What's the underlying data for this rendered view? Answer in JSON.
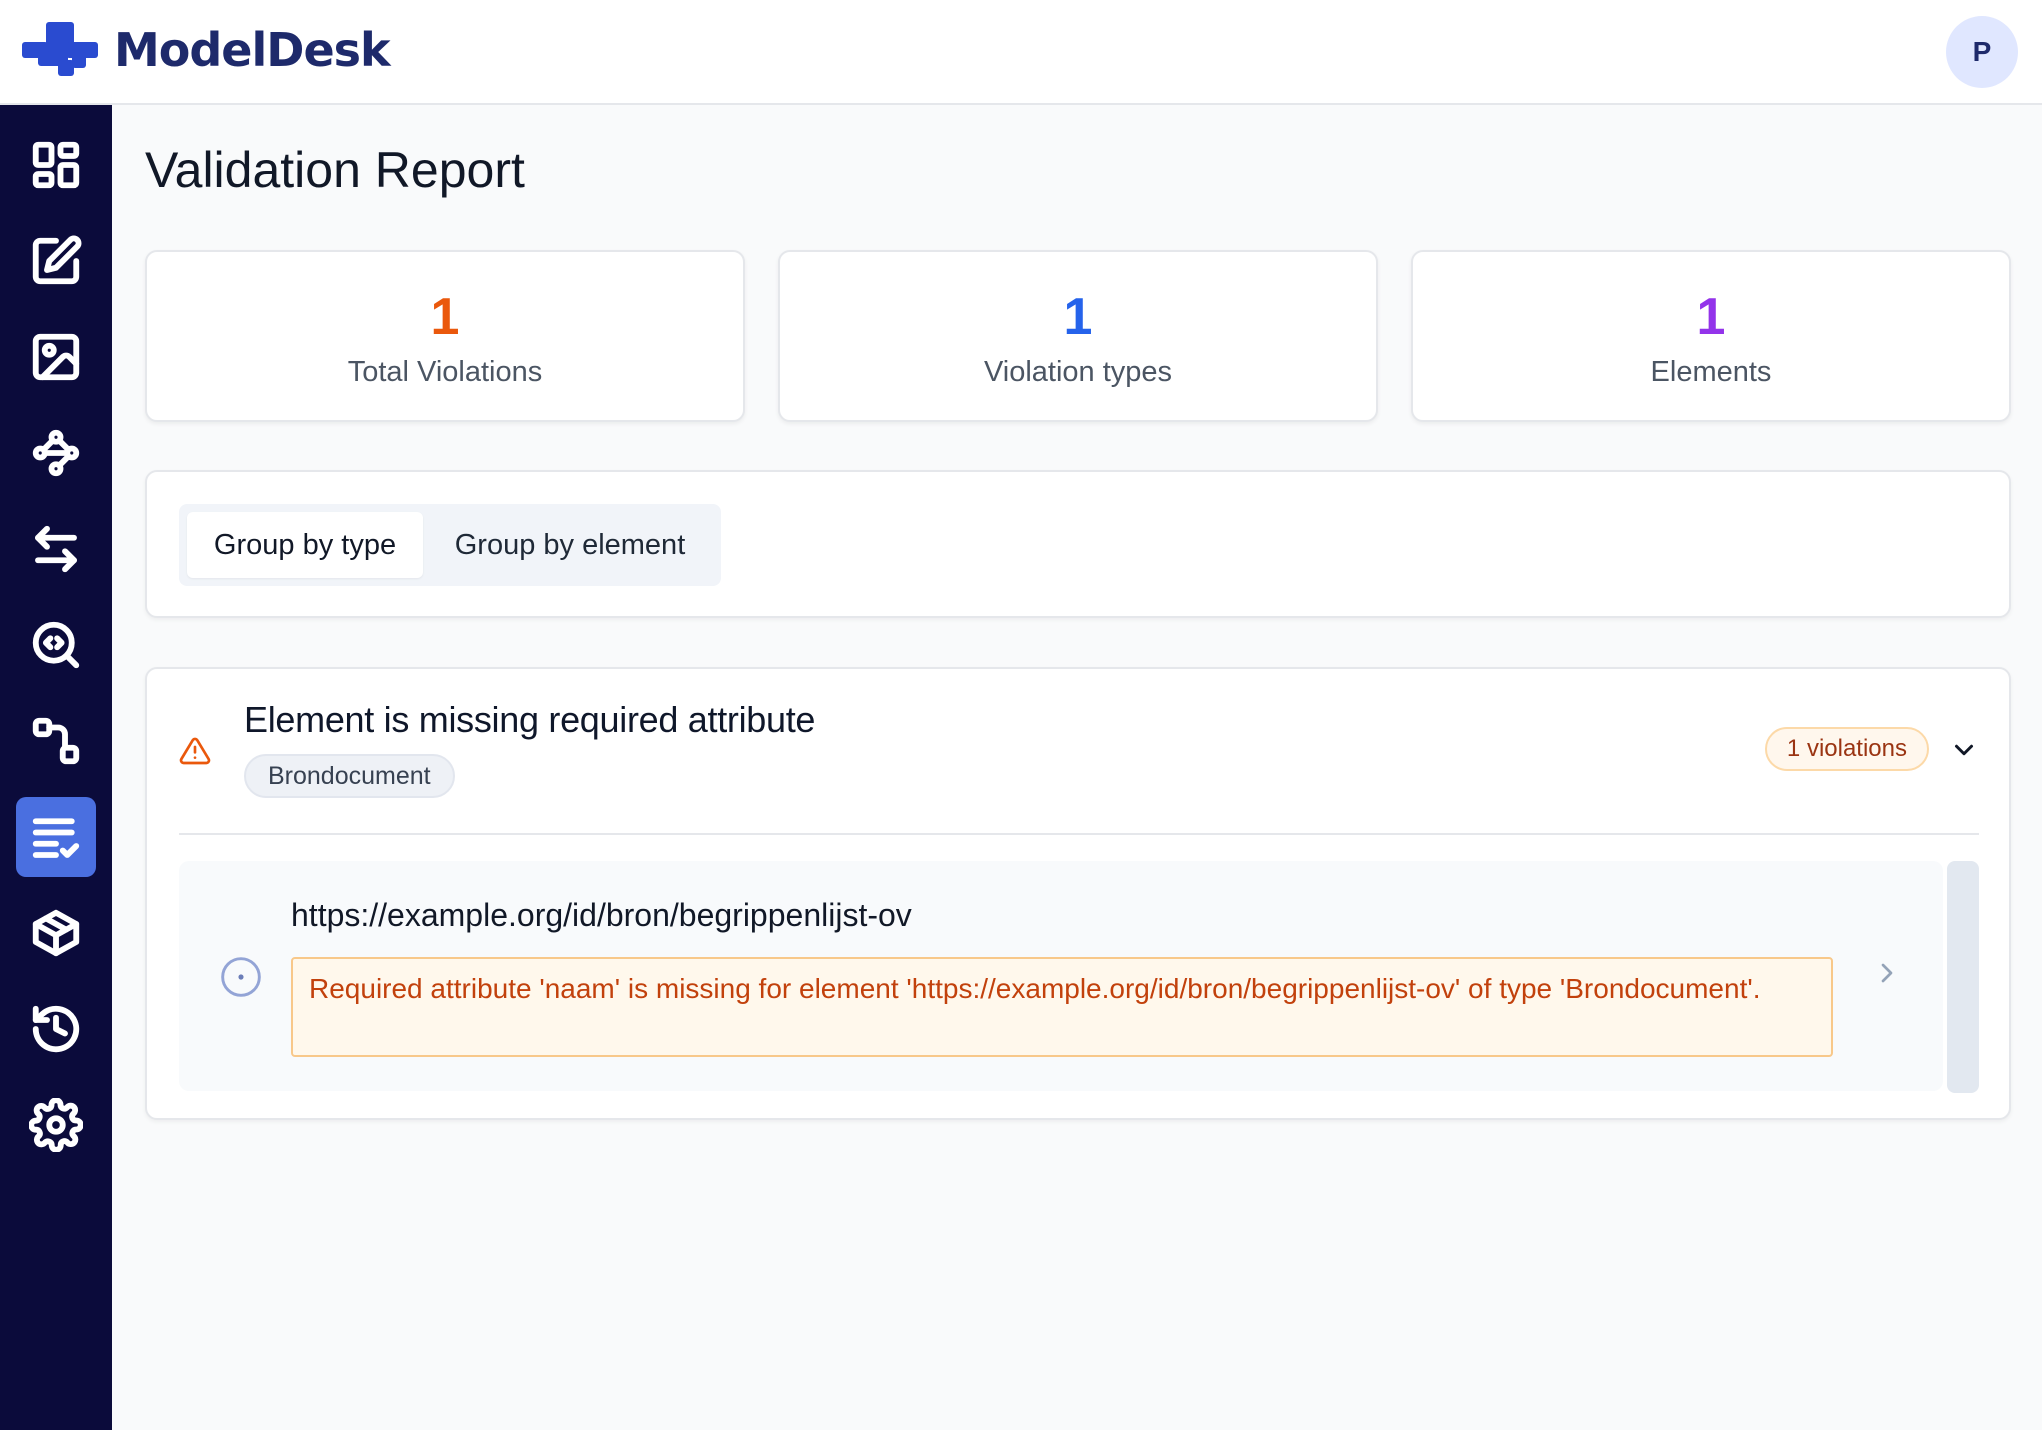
{
  "app": {
    "name": "ModelDesk",
    "user_initial": "P",
    "brand_color": "#2a4bd0",
    "sidebar_color": "#0b0b3b",
    "active_color": "#4a6fe0"
  },
  "sidebar": {
    "items": [
      {
        "icon": "dashboard-icon",
        "active": false
      },
      {
        "icon": "edit-icon",
        "active": false
      },
      {
        "icon": "image-icon",
        "active": false
      },
      {
        "icon": "graph-icon",
        "active": false
      },
      {
        "icon": "transfer-icon",
        "active": false
      },
      {
        "icon": "code-search-icon",
        "active": false
      },
      {
        "icon": "relations-icon",
        "active": false
      },
      {
        "icon": "validation-list-icon",
        "active": true
      },
      {
        "icon": "package-icon",
        "active": false
      },
      {
        "icon": "history-icon",
        "active": false
      },
      {
        "icon": "settings-icon",
        "active": false
      }
    ]
  },
  "page": {
    "title": "Validation Report"
  },
  "stats": [
    {
      "value": "1",
      "label": "Total Violations",
      "color": "#ea580c"
    },
    {
      "value": "1",
      "label": "Violation types",
      "color": "#2563eb"
    },
    {
      "value": "1",
      "label": "Elements",
      "color": "#9333ea"
    }
  ],
  "grouping": {
    "by_type": "Group by type",
    "by_element": "Group by element",
    "selected": "Group by type"
  },
  "violation_group": {
    "title": "Element is missing required attribute",
    "type_chip": "Brondocument",
    "count_badge": "1 violations",
    "items": [
      {
        "url": "https://example.org/id/bron/begrippenlijst-ov",
        "message": "Required attribute 'naam' is missing for element 'https://example.org/id/bron/begrippenlijst-ov' of type 'Brondocument'."
      }
    ]
  }
}
